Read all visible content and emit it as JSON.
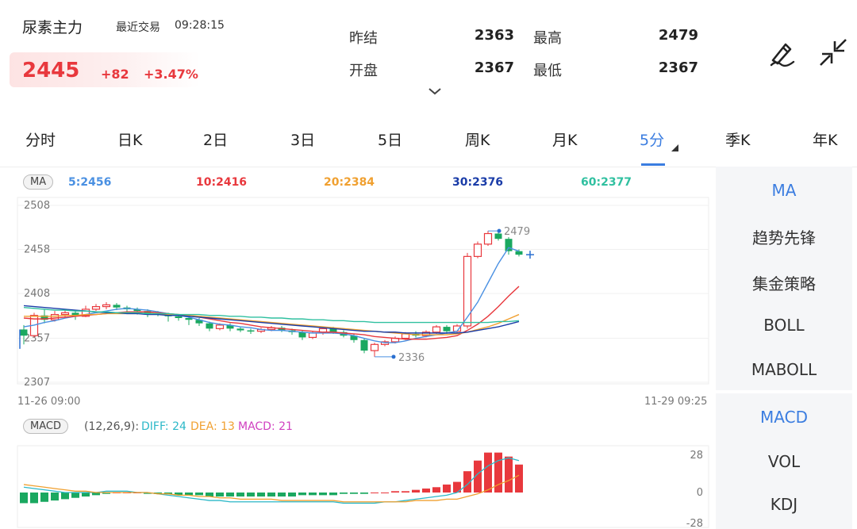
{
  "header": {
    "name": "尿素主力",
    "trade_label": "最近交易",
    "trade_time": "09:28:15",
    "price": "2445",
    "change": "+82",
    "change_pct": "+3.47%",
    "stats": [
      {
        "label": "昨结",
        "value": "2363"
      },
      {
        "label": "开盘",
        "value": "2367"
      },
      {
        "label": "最高",
        "value": "2479"
      },
      {
        "label": "最低",
        "value": "2367"
      }
    ],
    "icons": {
      "draw": "draw-pen-icon",
      "shrink": "collapse-arrows-icon",
      "expand": "chevron-down-icon"
    }
  },
  "tabs": [
    "分时",
    "日K",
    "2日",
    "3日",
    "5日",
    "周K",
    "月K",
    "5分",
    "季K",
    "年K"
  ],
  "active_tab": "5分",
  "ma_bar": {
    "badge": "MA",
    "items": [
      {
        "text": "5:2456",
        "color": "#4a90e2"
      },
      {
        "text": "10:2416",
        "color": "#e8383d"
      },
      {
        "text": "20:2384",
        "color": "#f0a030"
      },
      {
        "text": "30:2376",
        "color": "#1a3ca8"
      },
      {
        "text": "60:2377",
        "color": "#30c0a0"
      }
    ]
  },
  "main_chart": {
    "y_labels": [
      "2508",
      "2458",
      "2408",
      "2357",
      "2307"
    ],
    "x_start": "11-26 09:00",
    "x_end": "11-29 09:25",
    "high_label": "2479",
    "low_label": "2336"
  },
  "macd_bar": {
    "badge": "MACD",
    "params": "(12,26,9):",
    "diff": "DIFF: 24",
    "dea": "DEA: 13",
    "macd": "MACD: 21",
    "y_labels": [
      "28",
      "0",
      "-28"
    ]
  },
  "side_main": [
    "MA",
    "趋势先锋",
    "集金策略",
    "BOLL",
    "MABOLL"
  ],
  "side_sub": [
    "MACD",
    "VOL",
    "KDJ"
  ],
  "colors": {
    "up": "#e8383d",
    "down": "#1aa860",
    "accent": "#3b7de0"
  },
  "chart_data": {
    "type": "candlestick",
    "ylim": [
      2307,
      2508
    ],
    "candles": [
      [
        2367,
        2360,
        2372,
        2350
      ],
      [
        2360,
        2383,
        2386,
        2358
      ],
      [
        2383,
        2378,
        2390,
        2374
      ],
      [
        2378,
        2384,
        2388,
        2376
      ],
      [
        2384,
        2386,
        2390,
        2380
      ],
      [
        2386,
        2382,
        2389,
        2378
      ],
      [
        2382,
        2390,
        2394,
        2381
      ],
      [
        2390,
        2393,
        2396,
        2388
      ],
      [
        2393,
        2395,
        2398,
        2390
      ],
      [
        2395,
        2392,
        2397,
        2389
      ],
      [
        2392,
        2390,
        2394,
        2387
      ],
      [
        2390,
        2388,
        2392,
        2384
      ],
      [
        2388,
        2385,
        2390,
        2381
      ],
      [
        2385,
        2384,
        2388,
        2382
      ],
      [
        2384,
        2382,
        2386,
        2376
      ],
      [
        2382,
        2380,
        2384,
        2377
      ],
      [
        2380,
        2378,
        2382,
        2372
      ],
      [
        2378,
        2374,
        2380,
        2371
      ],
      [
        2374,
        2368,
        2376,
        2365
      ],
      [
        2368,
        2372,
        2374,
        2366
      ],
      [
        2372,
        2368,
        2374,
        2365
      ],
      [
        2368,
        2366,
        2370,
        2364
      ],
      [
        2366,
        2365,
        2368,
        2362
      ],
      [
        2365,
        2367,
        2369,
        2363
      ],
      [
        2367,
        2369,
        2371,
        2365
      ],
      [
        2369,
        2366,
        2371,
        2364
      ],
      [
        2366,
        2364,
        2368,
        2361
      ],
      [
        2364,
        2358,
        2366,
        2355
      ],
      [
        2358,
        2363,
        2365,
        2356
      ],
      [
        2363,
        2368,
        2370,
        2361
      ],
      [
        2368,
        2364,
        2370,
        2362
      ],
      [
        2364,
        2360,
        2366,
        2358
      ],
      [
        2360,
        2355,
        2362,
        2352
      ],
      [
        2355,
        2343,
        2357,
        2340
      ],
      [
        2343,
        2350,
        2352,
        2336
      ],
      [
        2350,
        2353,
        2355,
        2348
      ],
      [
        2353,
        2357,
        2359,
        2351
      ],
      [
        2357,
        2362,
        2364,
        2355
      ],
      [
        2362,
        2360,
        2365,
        2358
      ],
      [
        2360,
        2364,
        2366,
        2358
      ],
      [
        2364,
        2370,
        2372,
        2362
      ],
      [
        2370,
        2365,
        2372,
        2362
      ],
      [
        2365,
        2371,
        2373,
        2363
      ],
      [
        2371,
        2450,
        2454,
        2368
      ],
      [
        2450,
        2464,
        2467,
        2448
      ],
      [
        2464,
        2476,
        2479,
        2462
      ],
      [
        2476,
        2470,
        2479,
        2468
      ],
      [
        2470,
        2456,
        2472,
        2452
      ],
      [
        2456,
        2452,
        2458,
        2450
      ]
    ],
    "ma": {
      "ma5": [
        2370,
        2372,
        2375,
        2377,
        2380,
        2382,
        2384,
        2386,
        2388,
        2390,
        2391,
        2390,
        2389,
        2387,
        2385,
        2383,
        2381,
        2378,
        2375,
        2373,
        2372,
        2370,
        2369,
        2367,
        2366,
        2366,
        2365,
        2364,
        2363,
        2363,
        2363,
        2362,
        2360,
        2357,
        2354,
        2352,
        2352,
        2354,
        2357,
        2359,
        2361,
        2363,
        2365,
        2381,
        2398,
        2420,
        2442,
        2460,
        2456
      ],
      "ma10": [
        2380,
        2379,
        2379,
        2380,
        2381,
        2382,
        2383,
        2384,
        2385,
        2386,
        2387,
        2387,
        2387,
        2386,
        2385,
        2384,
        2383,
        2381,
        2379,
        2377,
        2375,
        2374,
        2372,
        2370,
        2369,
        2368,
        2367,
        2366,
        2365,
        2364,
        2364,
        2363,
        2362,
        2361,
        2359,
        2358,
        2357,
        2356,
        2356,
        2356,
        2357,
        2358,
        2360,
        2366,
        2373,
        2382,
        2393,
        2405,
        2416
      ],
      "ma20": [
        2382,
        2382,
        2382,
        2382,
        2383,
        2383,
        2384,
        2384,
        2385,
        2385,
        2385,
        2385,
        2385,
        2385,
        2384,
        2384,
        2383,
        2382,
        2381,
        2380,
        2379,
        2378,
        2377,
        2376,
        2375,
        2374,
        2373,
        2372,
        2371,
        2370,
        2369,
        2368,
        2367,
        2366,
        2365,
        2364,
        2363,
        2362,
        2361,
        2361,
        2361,
        2361,
        2362,
        2364,
        2367,
        2370,
        2374,
        2379,
        2384
      ],
      "ma30": [
        2394,
        2393,
        2392,
        2391,
        2390,
        2389,
        2388,
        2387,
        2386,
        2386,
        2385,
        2385,
        2384,
        2384,
        2383,
        2383,
        2382,
        2381,
        2380,
        2379,
        2378,
        2377,
        2376,
        2375,
        2374,
        2373,
        2372,
        2371,
        2370,
        2369,
        2368,
        2367,
        2366,
        2365,
        2365,
        2364,
        2364,
        2363,
        2363,
        2363,
        2363,
        2363,
        2363,
        2364,
        2366,
        2368,
        2370,
        2373,
        2376
      ],
      "ma60": [
        2392,
        2391,
        2390,
        2389,
        2389,
        2388,
        2388,
        2387,
        2387,
        2386,
        2386,
        2386,
        2385,
        2385,
        2385,
        2384,
        2384,
        2384,
        2383,
        2383,
        2382,
        2382,
        2381,
        2381,
        2380,
        2380,
        2379,
        2379,
        2378,
        2378,
        2377,
        2377,
        2376,
        2376,
        2375,
        2375,
        2375,
        2375,
        2375,
        2375,
        2375,
        2375,
        2375,
        2375,
        2375,
        2375,
        2376,
        2376,
        2377
      ]
    },
    "macd": {
      "hist": [
        -8,
        -8,
        -7,
        -6,
        -5,
        -4,
        -3,
        -2,
        -1,
        0,
        0,
        0,
        -1,
        -1,
        -1,
        -2,
        -2,
        -2,
        -3,
        -3,
        -3,
        -3,
        -3,
        -3,
        -3,
        -3,
        -3,
        -2,
        -2,
        -2,
        -2,
        -1,
        -1,
        -1,
        0,
        0,
        1,
        1,
        2,
        3,
        4,
        6,
        8,
        16,
        24,
        30,
        30,
        27,
        21
      ],
      "diff": [
        4,
        3,
        2,
        1,
        0,
        0,
        0,
        0,
        1,
        1,
        1,
        0,
        0,
        -1,
        -2,
        -3,
        -4,
        -5,
        -6,
        -6,
        -7,
        -7,
        -7,
        -7,
        -7,
        -7,
        -7,
        -7,
        -7,
        -7,
        -7,
        -8,
        -8,
        -8,
        -8,
        -7,
        -7,
        -6,
        -5,
        -4,
        -3,
        -2,
        0,
        6,
        14,
        20,
        24,
        26,
        24
      ],
      "dea": [
        6,
        5,
        4,
        3,
        2,
        1,
        1,
        0,
        0,
        0,
        0,
        0,
        0,
        -1,
        -1,
        -2,
        -2,
        -3,
        -3,
        -4,
        -4,
        -5,
        -5,
        -5,
        -5,
        -6,
        -6,
        -6,
        -6,
        -6,
        -6,
        -7,
        -7,
        -7,
        -7,
        -7,
        -7,
        -7,
        -6,
        -6,
        -6,
        -5,
        -5,
        -3,
        -1,
        2,
        6,
        9,
        13
      ]
    }
  }
}
